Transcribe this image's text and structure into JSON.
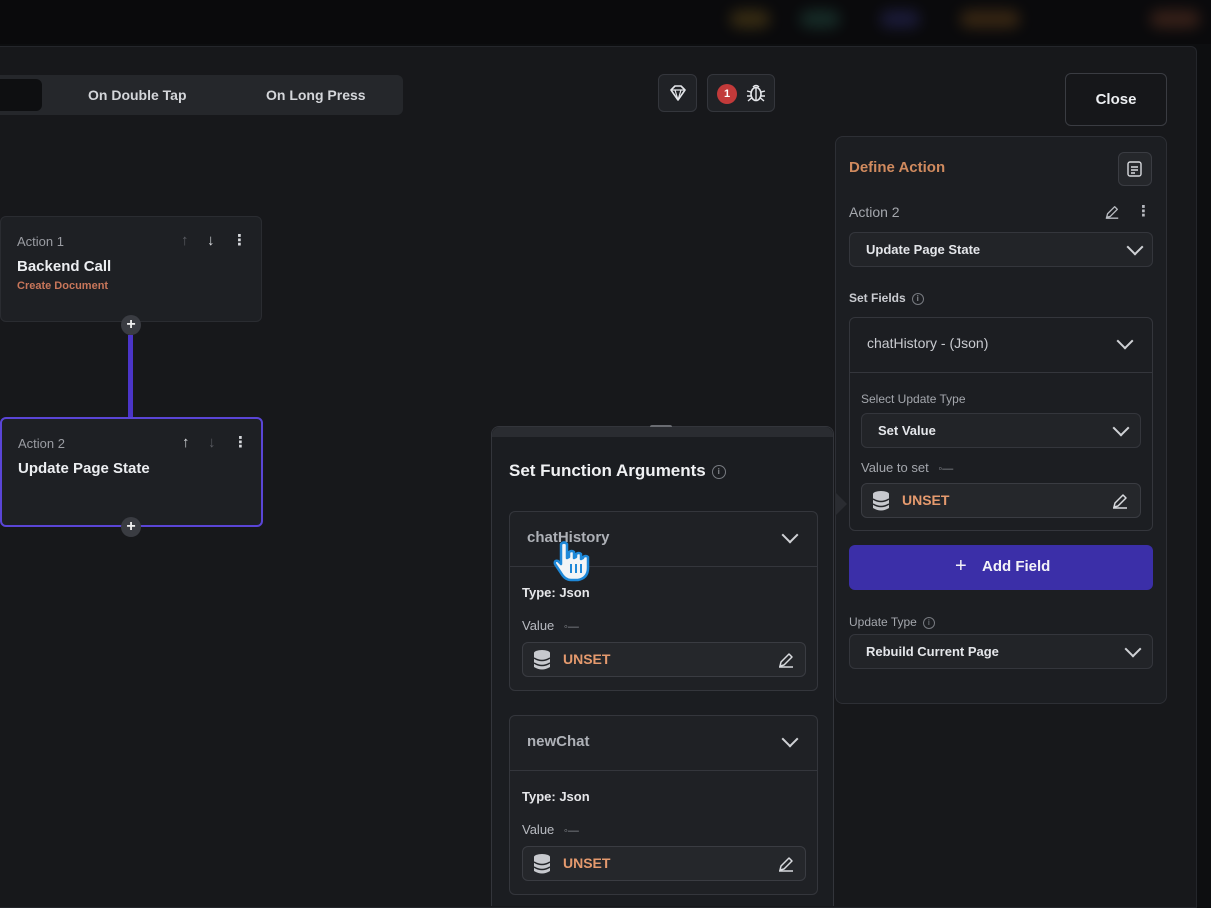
{
  "trigger_tabs": {
    "double_tap": "On Double Tap",
    "long_press": "On Long Press"
  },
  "toolbar": {
    "error_count": "1",
    "close_label": "Close"
  },
  "flow": {
    "action1": {
      "label": "Action 1",
      "title": "Backend Call",
      "subtitle": "Create Document"
    },
    "action2": {
      "label": "Action 2",
      "title": "Update Page State"
    }
  },
  "function_args": {
    "title": "Set Function Arguments",
    "args": [
      {
        "name": "chatHistory",
        "type": "Type: Json",
        "value_label": "Value",
        "value": "UNSET"
      },
      {
        "name": "newChat",
        "type": "Type: Json",
        "value_label": "Value",
        "value": "UNSET"
      }
    ]
  },
  "define_action": {
    "title": "Define Action",
    "action_label": "Action 2",
    "action_select": "Update Page State",
    "set_fields_label": "Set Fields",
    "field_name": "chatHistory - (Json)",
    "update_type_label": "Select Update Type",
    "update_type_value": "Set Value",
    "value_to_set_label": "Value to set",
    "value_to_set": "UNSET",
    "add_field": "Add Field",
    "page_update_label": "Update Type",
    "page_update_value": "Rebuild Current Page"
  },
  "colors": {
    "accent": "#3b2fa8",
    "flow_line": "#4b35c8",
    "unset": "#e59a6e",
    "subtitle": "#c8765a",
    "error_badge": "#c23a3a"
  }
}
